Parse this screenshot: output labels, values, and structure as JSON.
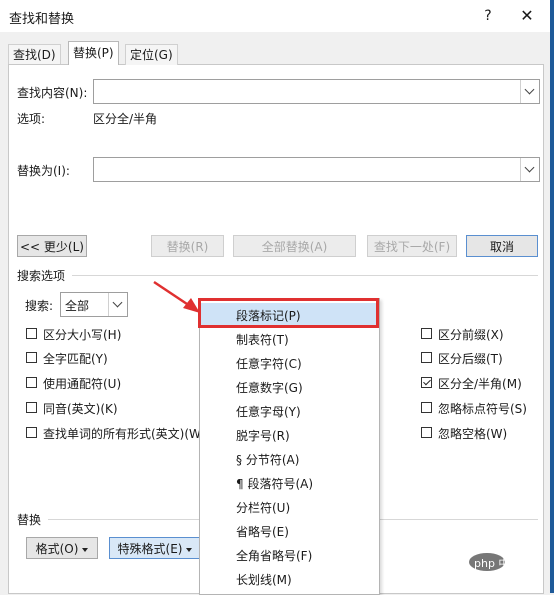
{
  "window": {
    "title": "查找和替换",
    "help": "?",
    "close": "✕"
  },
  "tabs": [
    {
      "label": "查找(D)",
      "active": false
    },
    {
      "label": "替换(P)",
      "active": true
    },
    {
      "label": "定位(G)",
      "active": false
    }
  ],
  "find": {
    "label": "查找内容(N):",
    "value": "",
    "options_label": "选项:",
    "options_value": "区分全/半角"
  },
  "replace": {
    "label": "替换为(I):",
    "value": ""
  },
  "buttons": {
    "less": "<< 更少(L)",
    "replace": "替换(R)",
    "replace_all": "全部替换(A)",
    "find_next": "查找下一处(F)",
    "cancel": "取消"
  },
  "search_options": {
    "section_title": "搜索选项",
    "search_label": "搜索:",
    "search_value": "全部",
    "left": [
      {
        "label": "区分大小写(H)",
        "checked": false
      },
      {
        "label": "全字匹配(Y)",
        "checked": false
      },
      {
        "label": "使用通配符(U)",
        "checked": false
      },
      {
        "label": "同音(英文)(K)",
        "checked": false
      },
      {
        "label": "查找单词的所有形式(英文)(W)",
        "checked": false
      }
    ],
    "right": [
      {
        "label": "区分前缀(X)",
        "checked": false
      },
      {
        "label": "区分后缀(T)",
        "checked": false
      },
      {
        "label": "区分全/半角(M)",
        "checked": true
      },
      {
        "label": "忽略标点符号(S)",
        "checked": false
      },
      {
        "label": "忽略空格(W)",
        "checked": false
      }
    ]
  },
  "replace_section": {
    "title": "替换",
    "format_button": "格式(O)",
    "special_button": "特殊格式(E)"
  },
  "special_menu": {
    "items": [
      "段落标记(P)",
      "制表符(T)",
      "任意字符(C)",
      "任意数字(G)",
      "任意字母(Y)",
      "脱字号(R)",
      "§ 分节符(A)",
      "¶ 段落符号(A)",
      "分栏符(U)",
      "省略号(E)",
      "全角省略号(F)",
      "长划线(M)"
    ],
    "highlighted_index": 0
  },
  "watermark": {
    "text": "php 中文网"
  },
  "colors": {
    "highlight_border": "#e03030",
    "menu_highlight": "#cfe3f7",
    "frame_blue": "#1e5a99"
  }
}
